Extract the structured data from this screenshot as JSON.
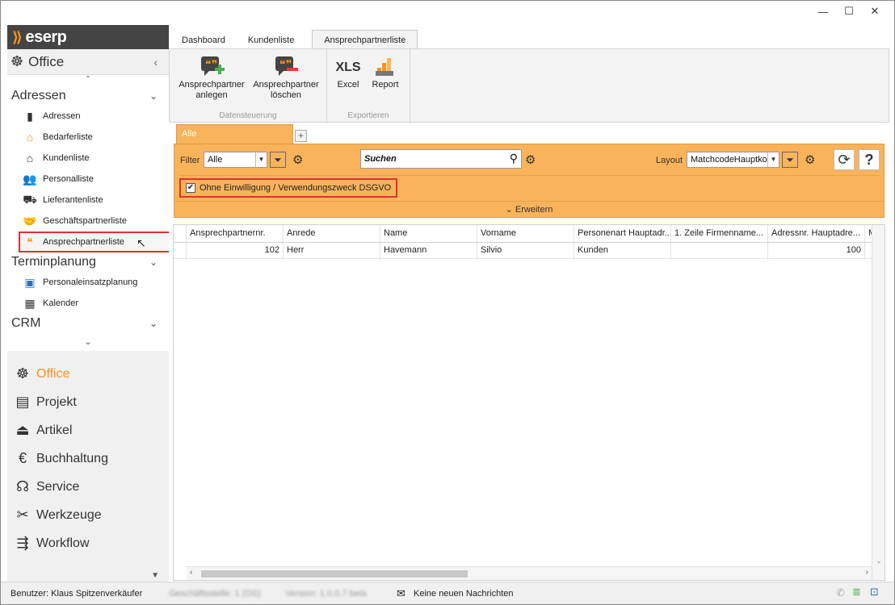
{
  "window": {
    "minimize": "—",
    "maximize": "☐",
    "close": "✕"
  },
  "logo": {
    "text": "eserp"
  },
  "sidebar": {
    "office_title": "Office",
    "sections": [
      {
        "title": "Adressen"
      },
      {
        "title": "Terminplanung"
      },
      {
        "title": "CRM"
      }
    ],
    "adressen_items": [
      {
        "label": "Adressen",
        "icon": "address-book-icon"
      },
      {
        "label": "Bedarferliste",
        "icon": "house-icon"
      },
      {
        "label": "Kundenliste",
        "icon": "house-dark-icon"
      },
      {
        "label": "Personalliste",
        "icon": "people-icon"
      },
      {
        "label": "Lieferantenliste",
        "icon": "truck-icon"
      },
      {
        "label": "Geschäftspartnerliste",
        "icon": "handshake-icon"
      },
      {
        "label": "Ansprechpartnerliste",
        "icon": "speech-quote-icon"
      }
    ],
    "termin_items": [
      {
        "label": "Personaleinsatzplanung",
        "icon": "person-calendar-icon"
      },
      {
        "label": "Kalender",
        "icon": "calendar-icon"
      }
    ],
    "modules": [
      {
        "label": "Office",
        "icon": "ship-wheel-icon",
        "active": true
      },
      {
        "label": "Projekt",
        "icon": "project-grid-icon"
      },
      {
        "label": "Artikel",
        "icon": "beacon-icon"
      },
      {
        "label": "Buchhaltung",
        "icon": "euro-icon"
      },
      {
        "label": "Service",
        "icon": "headset-icon"
      },
      {
        "label": "Werkzeuge",
        "icon": "tools-icon"
      },
      {
        "label": "Workflow",
        "icon": "workflow-icon"
      }
    ]
  },
  "ribbon": {
    "tabs": [
      "Dashboard",
      "Kundenliste",
      "Ansprechpartnerliste"
    ],
    "active_tab": "Ansprechpartnerliste",
    "groups": [
      {
        "label": "Datensteuerung",
        "buttons": [
          {
            "line1": "Ansprechpartner",
            "line2": "anlegen"
          },
          {
            "line1": "Ansprechpartner",
            "line2": "löschen"
          }
        ]
      },
      {
        "label": "Exportieren",
        "buttons": [
          {
            "line1": "Excel",
            "icon_text": "XLS"
          },
          {
            "line1": "Report"
          }
        ]
      }
    ]
  },
  "content": {
    "tab_label": "Alle",
    "add_tab": "+",
    "filter_label": "Filter",
    "filter_value": "Alle",
    "search_placeholder": "Suchen",
    "layout_label": "Layout",
    "layout_value": "MatchcodeHauptko",
    "checkbox_label": "Ohne Einwilligung / Verwendungszweck DSGVO",
    "checkbox_checked": true,
    "expand_label": "Erweitern"
  },
  "grid": {
    "columns": [
      "Ansprechpartnernr.",
      "Anrede",
      "Name",
      "Vorname",
      "Personenart Hauptadr...",
      "1. Zeile Firmenname...",
      "Adressnr. Hauptadre...",
      "M"
    ],
    "rows": [
      [
        "102",
        "Herr",
        "Havemann",
        "Silvio",
        "Kunden",
        "",
        "100",
        ""
      ]
    ]
  },
  "status": {
    "user": "Benutzer: Klaus Spitzenverkäufer",
    "branch": "Geschäftsstelle: 1 (OS)",
    "version": "Version: 1.0.0.7 beta",
    "messages": "Keine neuen Nachrichten"
  }
}
